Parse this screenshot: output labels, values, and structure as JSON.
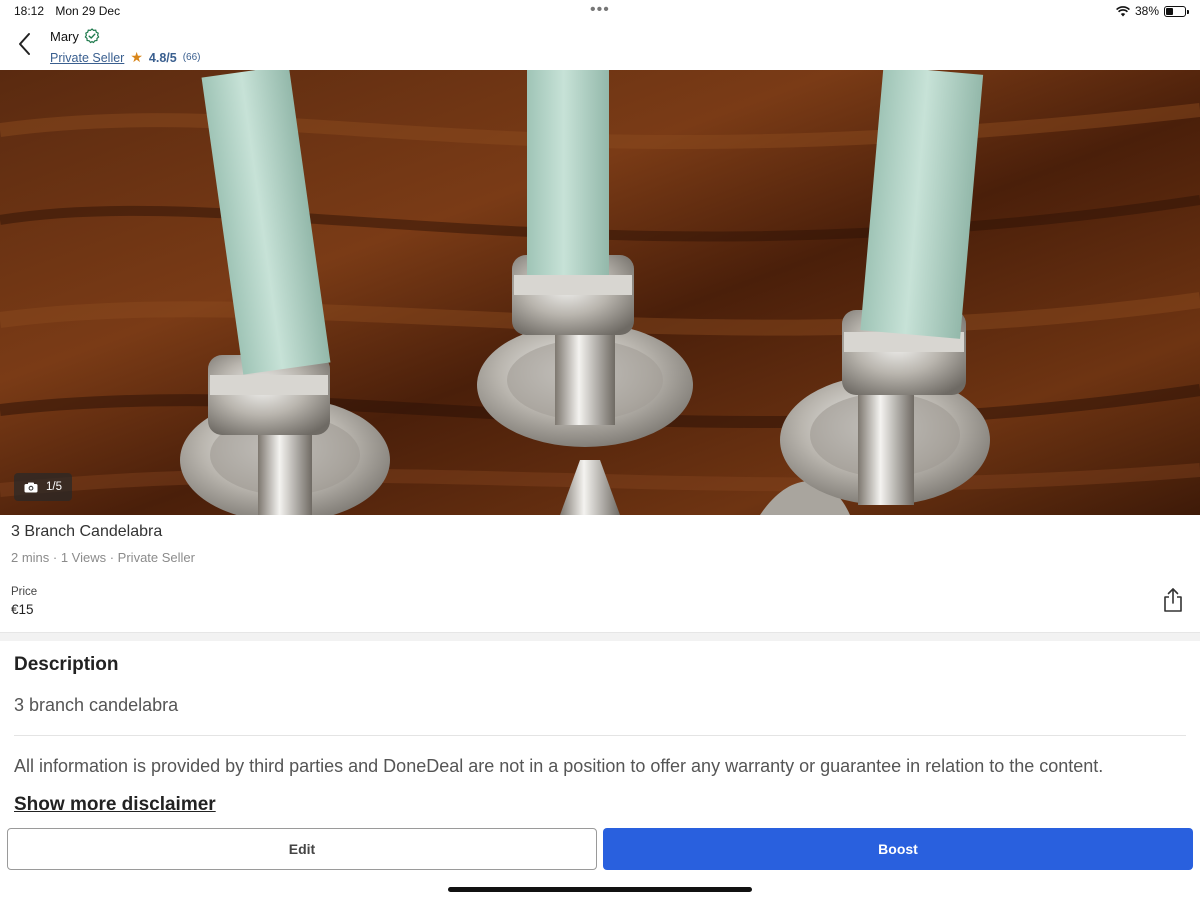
{
  "status_bar": {
    "time": "18:12",
    "date": "Mon 29 Dec",
    "dots": "•••",
    "battery": "38%",
    "battery_level": 0.38,
    "icons": [
      "wifi-icon",
      "battery-icon"
    ]
  },
  "header": {
    "seller_name": "Mary",
    "seller_type": "Private Seller",
    "rating": "4.8/5",
    "rating_count": "(66)",
    "icons": [
      "back-chevron-icon",
      "verified-check-icon",
      "star-icon"
    ],
    "accent_color": "#3a5f8f",
    "star_color": "#d9861a"
  },
  "photo": {
    "counter": "1/5",
    "icons": [
      "camera-icon"
    ]
  },
  "listing": {
    "title": "3 Branch Candelabra",
    "meta": "2 mins · 1 Views · Private Seller",
    "price_label": "Price",
    "price": "€15",
    "icons": [
      "share-icon"
    ]
  },
  "description": {
    "heading": "Description",
    "text": "3 branch candelabra",
    "disclaimer": "All information is provided by third parties and DoneDeal are not in a position to offer any warranty or guarantee in relation to the content.",
    "show_more": "Show more disclaimer"
  },
  "actions": {
    "edit_label": "Edit",
    "boost_label": "Boost",
    "boost_color": "#2960de"
  }
}
